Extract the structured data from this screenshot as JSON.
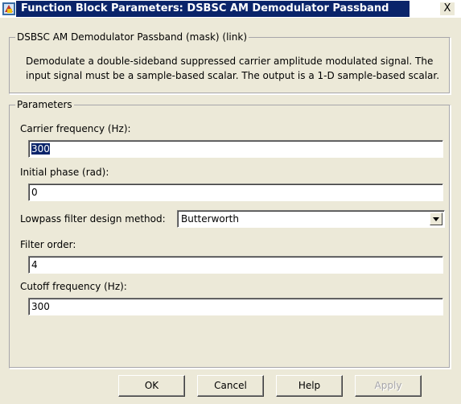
{
  "window": {
    "title": "Function Block Parameters: DSBSC AM Demodulator Passband",
    "close_label": "X"
  },
  "block": {
    "group_label": "DSBSC AM Demodulator Passband (mask) (link)",
    "description": "Demodulate a double-sideband suppressed carrier amplitude modulated signal. The input signal must be a sample-based scalar. The output is a 1-D sample-based scalar."
  },
  "parameters": {
    "group_label": "Parameters",
    "carrier_frequency": {
      "label": "Carrier frequency (Hz):",
      "value": "300"
    },
    "initial_phase": {
      "label": "Initial phase (rad):",
      "value": "0"
    },
    "filter_design": {
      "label": "Lowpass filter design method:",
      "value": "Butterworth"
    },
    "filter_order": {
      "label": "Filter order:",
      "value": "4"
    },
    "cutoff_frequency": {
      "label": "Cutoff frequency (Hz):",
      "value": "300"
    }
  },
  "buttons": {
    "ok": "OK",
    "cancel": "Cancel",
    "help": "Help",
    "apply": "Apply"
  },
  "icons": {
    "app_icon": "simulink-block-icon",
    "close_icon": "close-icon",
    "dropdown_icon": "chevron-down-icon"
  },
  "colors": {
    "title_bar": "#0a246a",
    "dialog_bg": "#ece9d8",
    "selection": "#0a246a"
  }
}
